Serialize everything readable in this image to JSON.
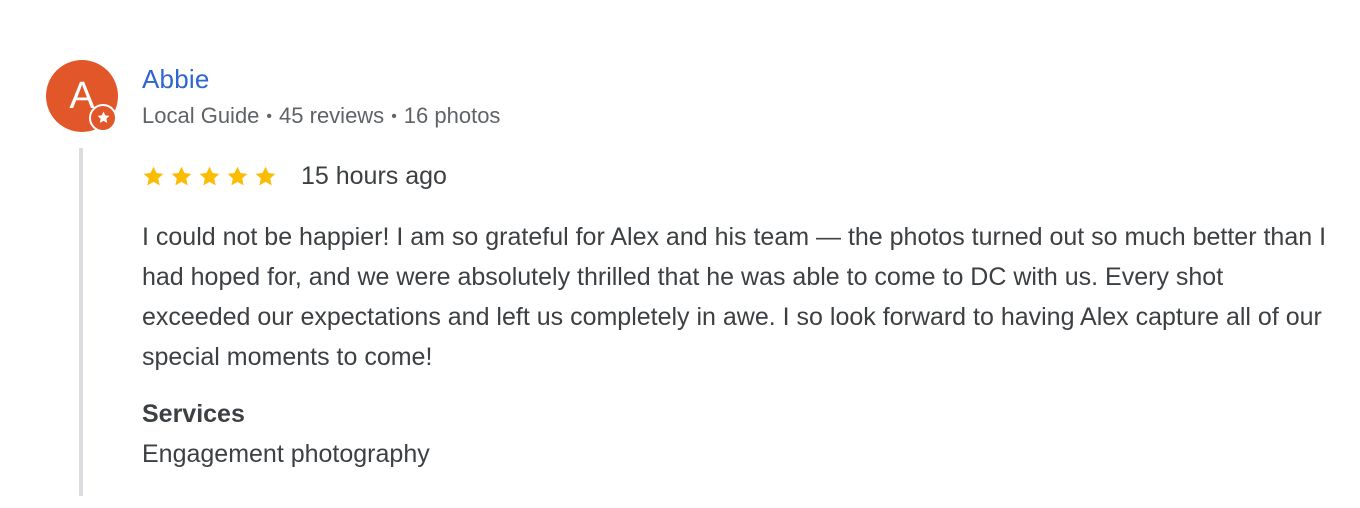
{
  "reviewer": {
    "initial": "A",
    "name": "Abbie",
    "badge_icon": "local-guide-star-icon",
    "meta": {
      "label": "Local Guide",
      "reviews": "45 reviews",
      "photos": "16 photos",
      "separator": "•"
    },
    "avatar_color": "#e2572a"
  },
  "review": {
    "rating": 5,
    "rating_max": 5,
    "star_color": "#fbbc04",
    "time": "15 hours ago",
    "text": "I could not be happier! I am so grateful for Alex and his team — the photos turned out so much better than I had hoped for, and we were absolutely thrilled that he was able to come to DC with us. Every shot exceeded our expectations and left us completely in awe. I so look forward to having Alex capture all of our special moments to come!",
    "services_label": "Services",
    "services_value": "Engagement photography"
  }
}
